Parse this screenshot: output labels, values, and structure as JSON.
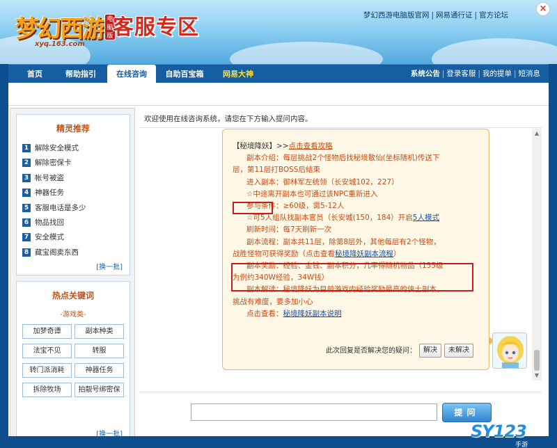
{
  "header": {
    "logo_text": "梦幻西游",
    "logo_badge": "电脑版",
    "logo_url": "xyq.163.com",
    "section_title": "客服专区",
    "top_links": [
      "梦幻西游电脑版官网",
      "网易通行证",
      "官方论坛"
    ],
    "separator": "|",
    "close_glyph": "×"
  },
  "nav": {
    "tabs": [
      {
        "label": "首页"
      },
      {
        "label": "帮助指引"
      },
      {
        "label": "在线咨询"
      },
      {
        "label": "自助百宝箱"
      },
      {
        "label": "网易大神"
      }
    ],
    "right_links": [
      "系统公告",
      "登录客服",
      "我的提单",
      "短消息"
    ]
  },
  "sidebar": {
    "recommend_title": "精灵推荐",
    "recommend_items": [
      {
        "num": "1",
        "label": "解除安全模式"
      },
      {
        "num": "2",
        "label": "解除密保卡"
      },
      {
        "num": "3",
        "label": "帐号被盗"
      },
      {
        "num": "4",
        "label": "神器任务"
      },
      {
        "num": "5",
        "label": "客服电话是多少"
      },
      {
        "num": "6",
        "label": "物品找回"
      },
      {
        "num": "7",
        "label": "安全模式"
      },
      {
        "num": "8",
        "label": "藏宝阁卖东西"
      }
    ],
    "swap_label": "[换一批]",
    "keywords_title": "热点关键词",
    "keywords_category": "-游戏类-",
    "keywords": [
      "加梦奇谭",
      "副本种类",
      "法宝不见",
      "转服",
      "转门派消耗",
      "神器任务",
      "拆除牧场",
      "拍靓号绑密保"
    ],
    "swap_label_2": "[换一批]"
  },
  "chat": {
    "welcome": "欢迎使用在线咨询系统，请您在下方输入提问内容。",
    "lines": {
      "l1a": "【秘境降妖】>>",
      "l1b": "点击查看攻略",
      "l2": "副本介绍：每层挑战2个怪物后找秘境散仙(坐标随机)传送下",
      "l3": "层，第11层打BOSS后结束",
      "l4": "进入副本：御林军左统领（长安城102，227）",
      "l5": "☆中途离开副本也可通过该NPC重新进入",
      "l6a": "参与条件：",
      "l6b": "≥60级，需5-12人",
      "l7a": "☆可5人组队找副本官员（长安城(150，184）开启",
      "l7b": "5人模式",
      "l8": "刷新时间：每7天刷新一次",
      "l9": "副本流程：副本共11层，除第8层外，其他每层有2个怪物，",
      "l10a": "战胜怪物可获得奖励（点击查看",
      "l10b": "秘境降妖副本流程",
      "l10c": "）",
      "l11": "副本奖励：经验、金钱、副本积分，几率得随机物品（155级",
      "l12": "为例约340W经验，34W钱）",
      "l13": "副本解读：秘境降妖为目前游戏内经验奖励最高的侠士副本，",
      "l14": "挑战有难度，要多加小心",
      "l15a": "点击查看：",
      "l15b": "秘境降妖副本说明"
    },
    "feedback_question": "此次回复是否解决您的疑问：",
    "btn_solved": "解决",
    "btn_unsolved": "未解决",
    "input_value": "",
    "ask_button": "提问"
  },
  "watermark": {
    "text": "SY123",
    "sub": "手游"
  },
  "colors": {
    "brand_blue": "#155e9f",
    "answer_orange": "#c44b14",
    "highlight_red": "#c81b1b",
    "link_blue": "#1b4f9c"
  }
}
